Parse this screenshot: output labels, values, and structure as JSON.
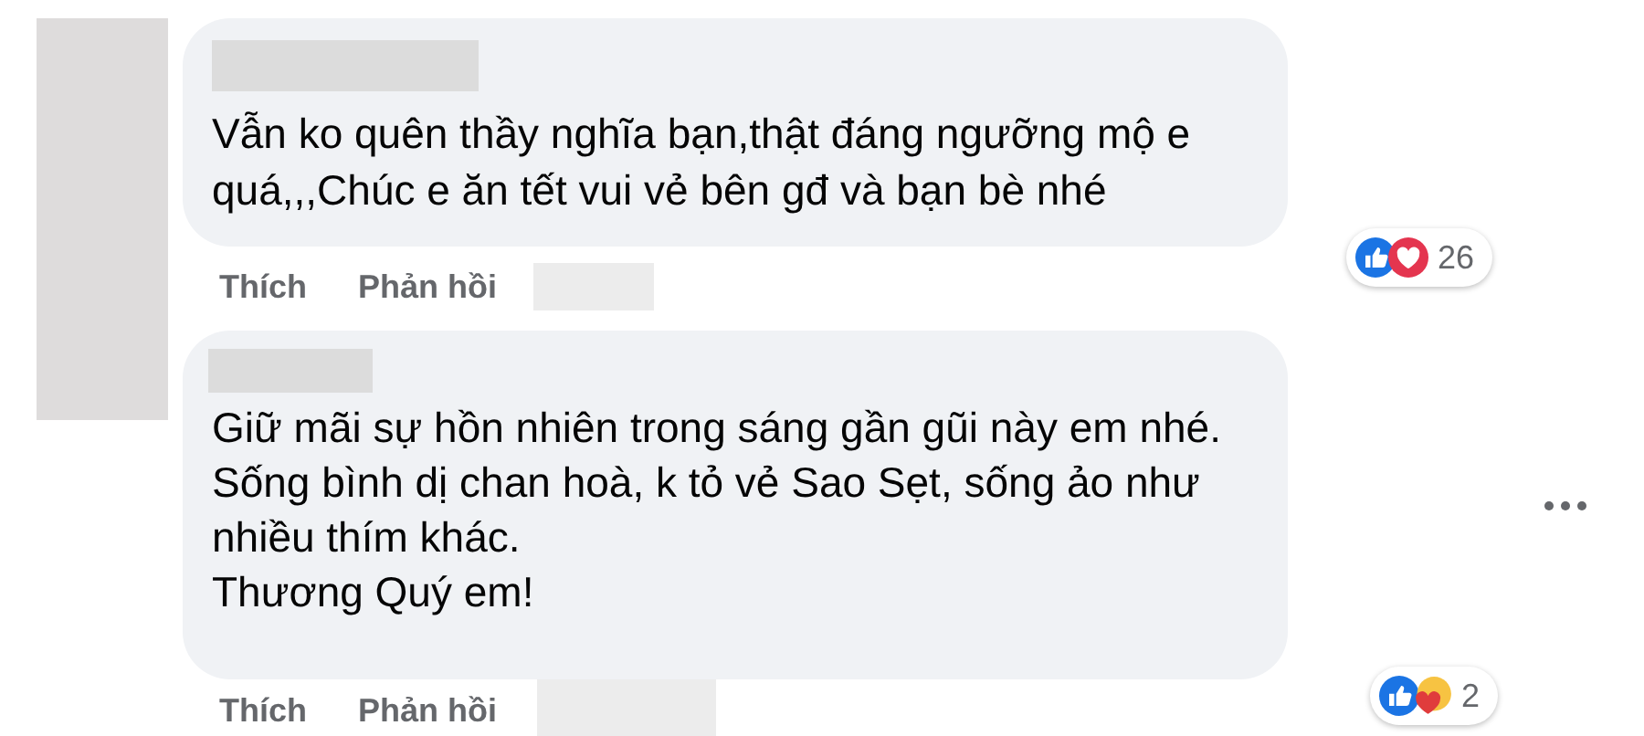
{
  "comments": [
    {
      "text": "Vẫn ko quên thầy nghĩa bạn,thật đáng ngưỡng mộ e\nquá,,,Chúc e ăn tết vui vẻ bên gđ và bạn bè nhé",
      "reactions": [
        {
          "kind": "like"
        },
        {
          "kind": "love"
        }
      ],
      "reaction_count": "26",
      "actions": [
        "Thích",
        "Phản hồi"
      ],
      "more_menu": false
    },
    {
      "text": "Giữ mãi sự hồn nhiên trong sáng gần gũi này em nhé.\nSống bình dị chan hoà, k tỏ vẻ Sao Sẹt, sống ảo như\nnhiều thím khác.\nThương Quý em!",
      "reactions": [
        {
          "kind": "like"
        },
        {
          "kind": "care"
        }
      ],
      "reaction_count": "2",
      "actions": [
        "Thích",
        "Phản hồi"
      ],
      "more_menu": true
    }
  ]
}
